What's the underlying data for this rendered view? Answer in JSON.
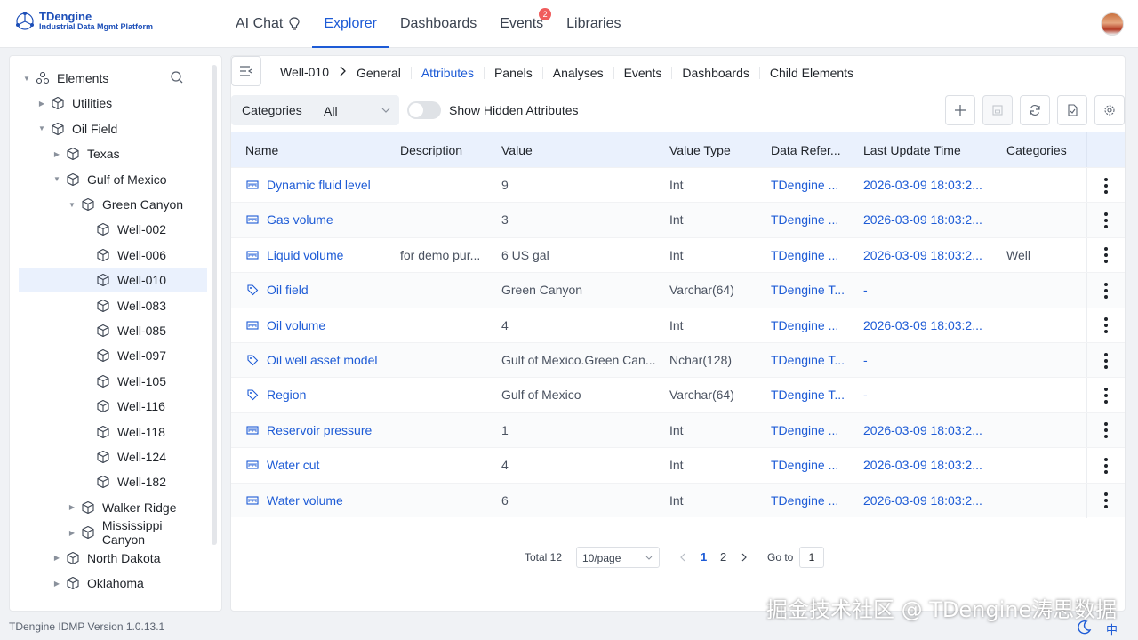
{
  "app": {
    "name": "TDengine",
    "subtitle": "Industrial Data Mgmt Platform",
    "version_text": "TDengine IDMP Version 1.0.13.1",
    "lang": "中",
    "watermark": "掘金技术社区 @ TDengine涛思数据",
    "accent_color": "#1d5bd6"
  },
  "nav": {
    "items": [
      {
        "label": "AI Chat",
        "icon": "lightbulb-icon",
        "active": false
      },
      {
        "label": "Explorer",
        "active": true
      },
      {
        "label": "Dashboards",
        "active": false
      },
      {
        "label": "Events",
        "badge": "2",
        "active": false
      },
      {
        "label": "Libraries",
        "active": false
      }
    ]
  },
  "tree": {
    "root": "Elements",
    "items": [
      {
        "label": "Utilities",
        "expanded": false
      },
      {
        "label": "Oil Field",
        "expanded": true
      },
      {
        "label": "Texas",
        "expanded": false
      },
      {
        "label": "Gulf of Mexico",
        "expanded": true
      },
      {
        "label": "Green Canyon",
        "expanded": true
      },
      {
        "label": "Well-002"
      },
      {
        "label": "Well-006"
      },
      {
        "label": "Well-010",
        "selected": true
      },
      {
        "label": "Well-083"
      },
      {
        "label": "Well-085"
      },
      {
        "label": "Well-097"
      },
      {
        "label": "Well-105"
      },
      {
        "label": "Well-116"
      },
      {
        "label": "Well-118"
      },
      {
        "label": "Well-124"
      },
      {
        "label": "Well-182"
      },
      {
        "label": "Walker Ridge",
        "expanded": false
      },
      {
        "label": "Mississippi Canyon",
        "expanded": false
      },
      {
        "label": "North Dakota",
        "expanded": false
      },
      {
        "label": "Oklahoma",
        "expanded": false
      }
    ]
  },
  "detail": {
    "title": "Well-010",
    "tabs": [
      {
        "label": "General",
        "active": false
      },
      {
        "label": "Attributes",
        "active": true
      },
      {
        "label": "Panels",
        "active": false
      },
      {
        "label": "Analyses",
        "active": false
      },
      {
        "label": "Events",
        "active": false
      },
      {
        "label": "Dashboards",
        "active": false
      },
      {
        "label": "Child Elements",
        "active": false
      }
    ]
  },
  "toolbar": {
    "categories_label": "Categories",
    "categories_value": "All",
    "show_hidden_label": "Show Hidden Attributes",
    "show_hidden": false
  },
  "table": {
    "columns": [
      "Name",
      "Description",
      "Value",
      "Value Type",
      "Data Refer...",
      "Last Update Time",
      "Categories"
    ],
    "rows": [
      {
        "icon": "measurement-icon",
        "name": "Dynamic fluid level",
        "description": "",
        "value": "9",
        "value_type": "Int",
        "data_ref": "TDengine ...",
        "updated": "2026-03-09 18:03:2...",
        "categories": ""
      },
      {
        "icon": "measurement-icon",
        "name": "Gas volume",
        "description": "",
        "value": "3",
        "value_type": "Int",
        "data_ref": "TDengine ...",
        "updated": "2026-03-09 18:03:2...",
        "categories": ""
      },
      {
        "icon": "measurement-icon",
        "name": "Liquid volume",
        "description": "for demo pur...",
        "value": "6 US gal",
        "value_type": "Int",
        "data_ref": "TDengine ...",
        "updated": "2026-03-09 18:03:2...",
        "categories": "Well"
      },
      {
        "icon": "tag-icon",
        "name": "Oil field",
        "description": "",
        "value": "Green Canyon",
        "value_type": "Varchar(64)",
        "data_ref": "TDengine T...",
        "updated": "-",
        "categories": ""
      },
      {
        "icon": "measurement-icon",
        "name": "Oil volume",
        "description": "",
        "value": "4",
        "value_type": "Int",
        "data_ref": "TDengine ...",
        "updated": "2026-03-09 18:03:2...",
        "categories": ""
      },
      {
        "icon": "tag-icon",
        "name": "Oil well asset model",
        "description": "",
        "value": "Gulf of Mexico.Green Can...",
        "value_type": "Nchar(128)",
        "data_ref": "TDengine T...",
        "updated": "-",
        "categories": ""
      },
      {
        "icon": "tag-icon",
        "name": "Region",
        "description": "",
        "value": "Gulf of Mexico",
        "value_type": "Varchar(64)",
        "data_ref": "TDengine T...",
        "updated": "-",
        "categories": ""
      },
      {
        "icon": "measurement-icon",
        "name": "Reservoir pressure",
        "description": "",
        "value": "1",
        "value_type": "Int",
        "data_ref": "TDengine ...",
        "updated": "2026-03-09 18:03:2...",
        "categories": ""
      },
      {
        "icon": "measurement-icon",
        "name": "Water cut",
        "description": "",
        "value": "4",
        "value_type": "Int",
        "data_ref": "TDengine ...",
        "updated": "2026-03-09 18:03:2...",
        "categories": ""
      },
      {
        "icon": "measurement-icon",
        "name": "Water volume",
        "description": "",
        "value": "6",
        "value_type": "Int",
        "data_ref": "TDengine ...",
        "updated": "2026-03-09 18:03:2...",
        "categories": ""
      }
    ]
  },
  "pagination": {
    "total": "Total 12",
    "page_size": "10/page",
    "pages": [
      "1",
      "2"
    ],
    "current": "1",
    "goto_label": "Go to",
    "goto_value": "1"
  }
}
